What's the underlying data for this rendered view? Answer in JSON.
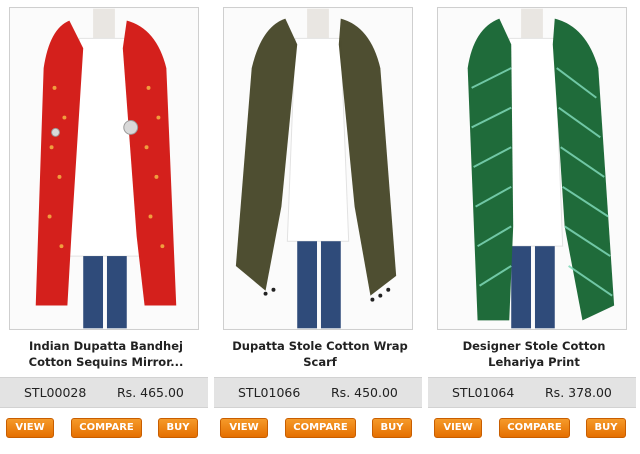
{
  "products": [
    {
      "title_line1": "Indian Dupatta Bandhej",
      "title_line2": "Cotton Sequins Mirror...",
      "sku": "STL00028",
      "price": "Rs. 465.00",
      "view_label": "VIEW",
      "compare_label": "COMPARE",
      "buy_label": "BUY",
      "image_icon": "red-bandhej-dupatta-image",
      "main_color": "#d4201c"
    },
    {
      "title_line1": "Dupatta Stole Cotton Wrap",
      "title_line2": "Scarf",
      "sku": "STL01066",
      "price": "Rs. 450.00",
      "view_label": "VIEW",
      "compare_label": "COMPARE",
      "buy_label": "BUY",
      "image_icon": "olive-cotton-stole-image",
      "main_color": "#3f3f1f"
    },
    {
      "title_line1": "Designer Stole Cotton",
      "title_line2": "Lehariya Print",
      "sku": "STL01064",
      "price": "Rs. 378.00",
      "view_label": "VIEW",
      "compare_label": "COMPARE",
      "buy_label": "BUY",
      "image_icon": "green-lehariya-stole-image",
      "main_color": "#1f6b3a"
    }
  ],
  "colors": {
    "button_orange": "#f08a1c",
    "price_bar_bg": "#e3e3e3"
  }
}
